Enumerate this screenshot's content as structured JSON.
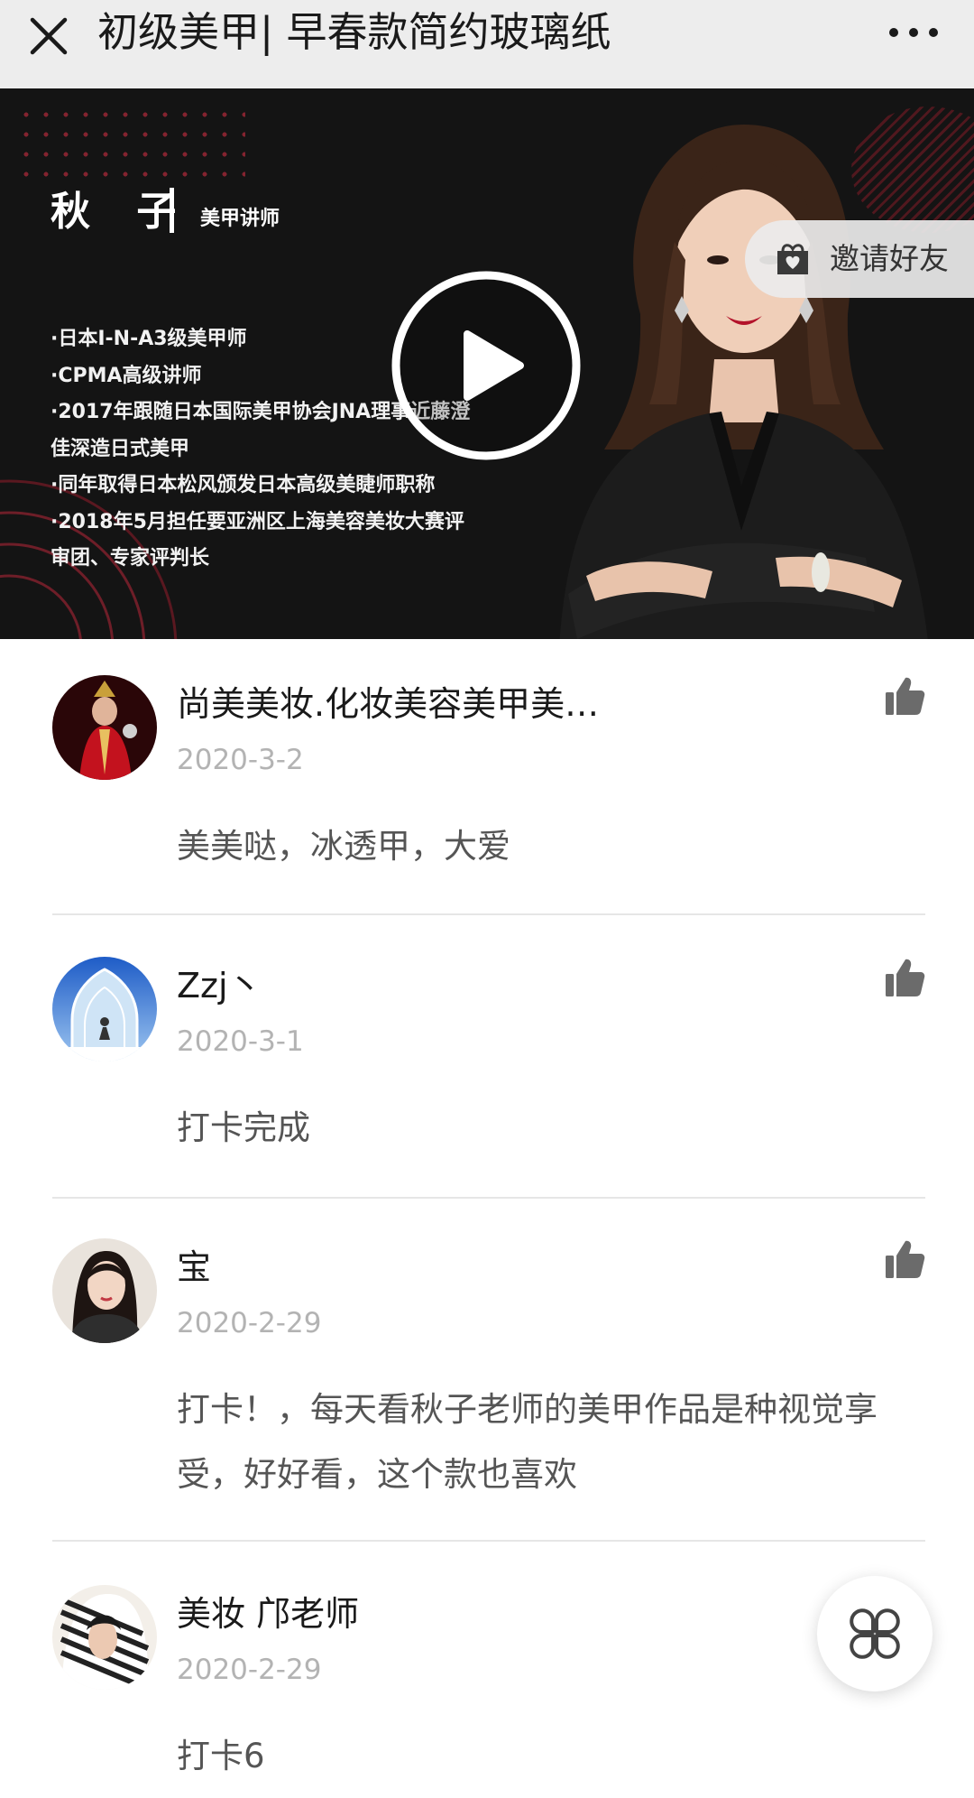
{
  "header": {
    "title": "初级美甲| 早春款简约玻璃纸",
    "close_icon": "close-icon",
    "more_icon": "more-dots-icon"
  },
  "video": {
    "teacher_name": "秋 子",
    "teacher_role": "美甲讲师",
    "bio_lines": [
      "·日本I-N-A3级美甲师",
      "·CPMA高级讲师",
      "·2017年跟随日本国际美甲协会JNA理事近藤澄",
      "佳深造日式美甲",
      "·同年取得日本松风颁发日本高级美睫师职称",
      "·2018年5月担任要亚洲区上海美容美妆大赛评",
      "审团、专家评判长"
    ],
    "play_icon": "play-icon",
    "invite_label": "邀请好友",
    "invite_icon": "gift-heart-icon",
    "accent_color": "#8a2430"
  },
  "comments": [
    {
      "name": "尚美美妆.化妆美容美甲美…",
      "date": "2020-3-2",
      "text": "美美哒，冰透甲，大爱"
    },
    {
      "name": "Zzj丶",
      "date": "2020-3-1",
      "text": "打卡完成"
    },
    {
      "name": "宝",
      "date": "2020-2-29",
      "text": "打卡！，每天看秋子老师的美甲作品是种视觉享受，好好看，这个款也喜欢"
    },
    {
      "name": "美妆 邝老师",
      "date": "2020-2-29",
      "text": "打卡6"
    }
  ],
  "fab_icon": "menu-grid-icon",
  "colors": {
    "topbar_bg": "#ededed",
    "date_gray": "#b3b3b3",
    "text_gray": "#555555"
  }
}
